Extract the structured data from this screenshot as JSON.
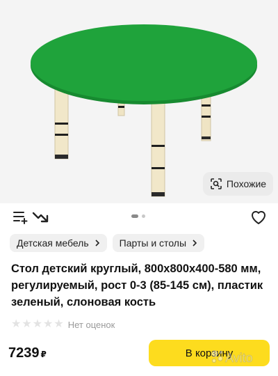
{
  "gallery": {
    "image_subject": "green-round-table",
    "table_color": "#1fa33b",
    "leg_color": "#efe4c4",
    "similar_button": {
      "label": "Похожие",
      "icon": "image-search-icon"
    },
    "page_indicator": {
      "count": 3,
      "active": 0
    }
  },
  "toolbar": {
    "compare_icon": "add-to-list-icon",
    "price_drop_icon": "price-trend-down-icon",
    "favorite_icon": "heart-outline-icon"
  },
  "breadcrumbs": [
    {
      "label": "Детская мебель"
    },
    {
      "label": "Парты и столы"
    }
  ],
  "product": {
    "title": "Стол детский круглый, 800x800x400-580 мм, регулируемый, рост 0-3 (85-145 см), пластик зеленый, слоновая кость",
    "rating_text": "Нет оценок",
    "rating_value": 0,
    "rating_max": 5,
    "price": "7239",
    "currency": "₽"
  },
  "actions": {
    "cart_label": "В корзину",
    "cart_color": "#fddc1e"
  },
  "watermark": {
    "text": "Avito"
  }
}
